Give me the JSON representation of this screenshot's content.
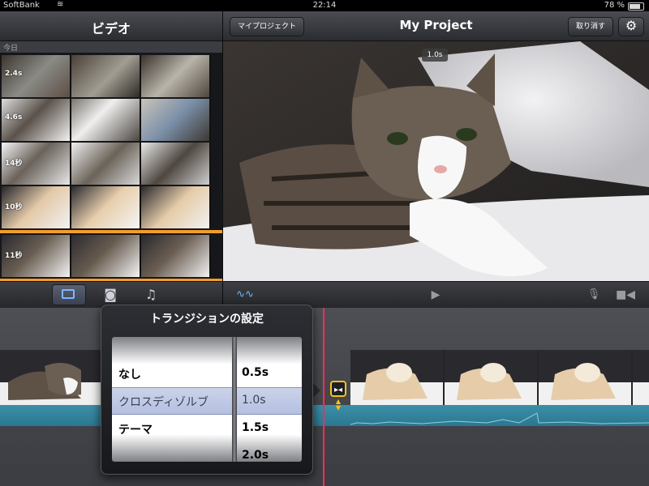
{
  "status_bar": {
    "carrier": "SoftBank",
    "time": "22:14",
    "battery": "78 %"
  },
  "left_panel": {
    "title": "ビデオ",
    "section": "今日",
    "clips": [
      {
        "duration": "2.4s"
      },
      {
        "duration": "4.6s"
      },
      {
        "duration": "14秒"
      },
      {
        "duration": "10秒",
        "used": true
      },
      {
        "duration": "11秒",
        "used": true
      }
    ],
    "toolbar": {
      "video_icon": "video-icon",
      "photo_icon": "camera-icon",
      "music_icon": "music-note-icon"
    }
  },
  "project": {
    "my_projects_label": "マイプロジェクト",
    "title": "My Project",
    "undo_label": "取り消す",
    "clip_duration_badge": "1.0s"
  },
  "popover": {
    "title": "トランジションの設定",
    "types": [
      "なし",
      "クロスディゾルブ",
      "テーマ"
    ],
    "selected_type": "クロスディゾルブ",
    "durations": [
      "0.5s",
      "1.0s",
      "1.5s",
      "2.0s"
    ],
    "selected_duration": "1.0s"
  },
  "colors": {
    "accent_orange": "#f39c2b",
    "playhead": "#ff2d5a",
    "transition_highlight": "#f6c31e",
    "audio_track": "#2b7791"
  }
}
